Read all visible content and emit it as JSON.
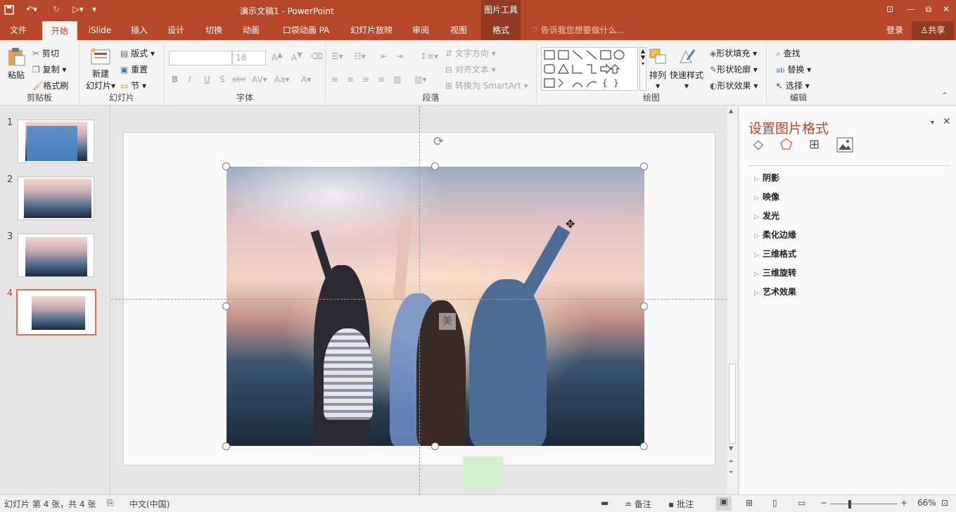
{
  "titlebar": {
    "doc_title": "演示文稿1 - PowerPoint",
    "context_tab_group": "图片工具",
    "undo_icon": "undo-icon",
    "redo_icon": "redo-icon",
    "save_icon": "save-icon",
    "window_buttons": [
      "⊡",
      "—",
      "⧉",
      "✕"
    ]
  },
  "tabs": [
    "文件",
    "开始",
    "iSlide",
    "插入",
    "设计",
    "切换",
    "动画",
    "口袋动画 PA",
    "幻灯片放映",
    "审阅",
    "视图",
    "格式"
  ],
  "active_tab": "开始",
  "tell_me": "告诉我您想要做什么...",
  "login": "登录",
  "share": "共享",
  "ribbon": {
    "clipboard": {
      "label": "剪贴板",
      "paste": "粘贴",
      "cut": "剪切",
      "copy": "复制",
      "format_painter": "格式刷"
    },
    "slides": {
      "label": "幻灯片",
      "new_slide_1": "新建",
      "new_slide_2": "幻灯片",
      "layout": "版式",
      "reset": "重置",
      "section": "节"
    },
    "font": {
      "label": "字体",
      "font_name": "",
      "font_size": "18",
      "bold": "B",
      "italic": "I",
      "underline": "U",
      "shadow": "S",
      "strike": "abc",
      "spacing": "AV",
      "case": "Aa",
      "color": "A",
      "grow": "A",
      "shrink": "A"
    },
    "paragraph": {
      "label": "段落",
      "text_direction": "文字方向",
      "align_text": "对齐文本",
      "smartart": "转换为 SmartArt"
    },
    "drawing": {
      "label": "绘图",
      "arrange": "排列",
      "quick_styles": "快速样式",
      "shape_fill": "形状填充",
      "shape_outline": "形状轮廓",
      "shape_effect": "形状效果"
    },
    "editing": {
      "label": "编辑",
      "find": "查找",
      "replace": "替换",
      "select": "选择"
    }
  },
  "slides": [
    {
      "number": "1"
    },
    {
      "number": "2"
    },
    {
      "number": "3"
    },
    {
      "number": "4"
    }
  ],
  "selected_slide": "4",
  "format_pane": {
    "title": "设置图片格式",
    "tabs": [
      "fill-line-icon",
      "effects-icon",
      "size-properties-icon",
      "picture-icon"
    ],
    "properties": [
      "阴影",
      "映像",
      "发光",
      "柔化边缘",
      "三维格式",
      "三维旋转",
      "艺术效果"
    ]
  },
  "slide_overlay_char": "美",
  "status": {
    "slide_info": "幻灯片 第 4 张，共 4 张",
    "language": "中文(中国)",
    "notes": "备注",
    "comments": "批注",
    "zoom": "66%"
  },
  "colors": {
    "accent": "#b7472a",
    "selected_thumb_border": "#e07050"
  }
}
